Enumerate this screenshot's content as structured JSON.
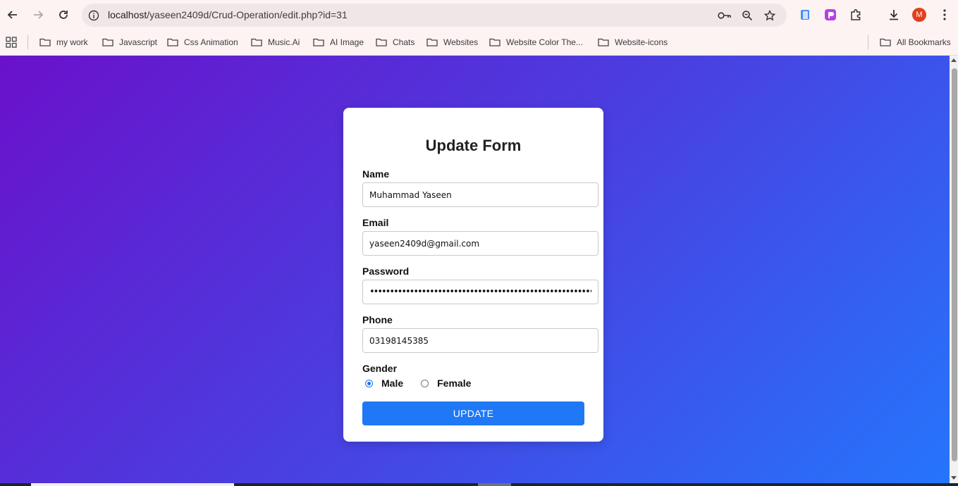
{
  "browser": {
    "url_host": "localhost",
    "url_path": "/yaseen2409d/Crud-Operation/edit.php?id=31",
    "avatar_letter": "M",
    "icons": [
      "back-icon",
      "forward-icon",
      "reload-icon",
      "site-info-icon",
      "key-icon",
      "zoom-icon",
      "star-icon",
      "extension-icon",
      "extension-icon",
      "puzzle-icon",
      "download-icon",
      "more-icon"
    ]
  },
  "bookmarks": {
    "items": [
      {
        "label": "my work"
      },
      {
        "label": "Javascript"
      },
      {
        "label": "Css Animation"
      },
      {
        "label": "Music.Ai"
      },
      {
        "label": "AI Image"
      },
      {
        "label": "Chats"
      },
      {
        "label": "Websites"
      },
      {
        "label": "Website Color The..."
      },
      {
        "label": "Website-icons"
      }
    ],
    "all_bookmarks": "All Bookmarks"
  },
  "form": {
    "title": "Update Form",
    "name_label": "Name",
    "name_value": "Muhammad Yaseen",
    "email_label": "Email",
    "email_value": "yaseen2409d@gmail.com",
    "password_label": "Password",
    "password_value": "••••••••••••••••••••••••••••••••••••••••••••••••••••••••••••",
    "phone_label": "Phone",
    "phone_value": "03198145385",
    "gender_label": "Gender",
    "gender_options": [
      "Male",
      "Female"
    ],
    "gender_selected": "Male",
    "submit_label": "UPDATE"
  },
  "colors": {
    "gradient_start": "#6a11cb",
    "gradient_end": "#2575fc",
    "button": "#1f78f5"
  }
}
